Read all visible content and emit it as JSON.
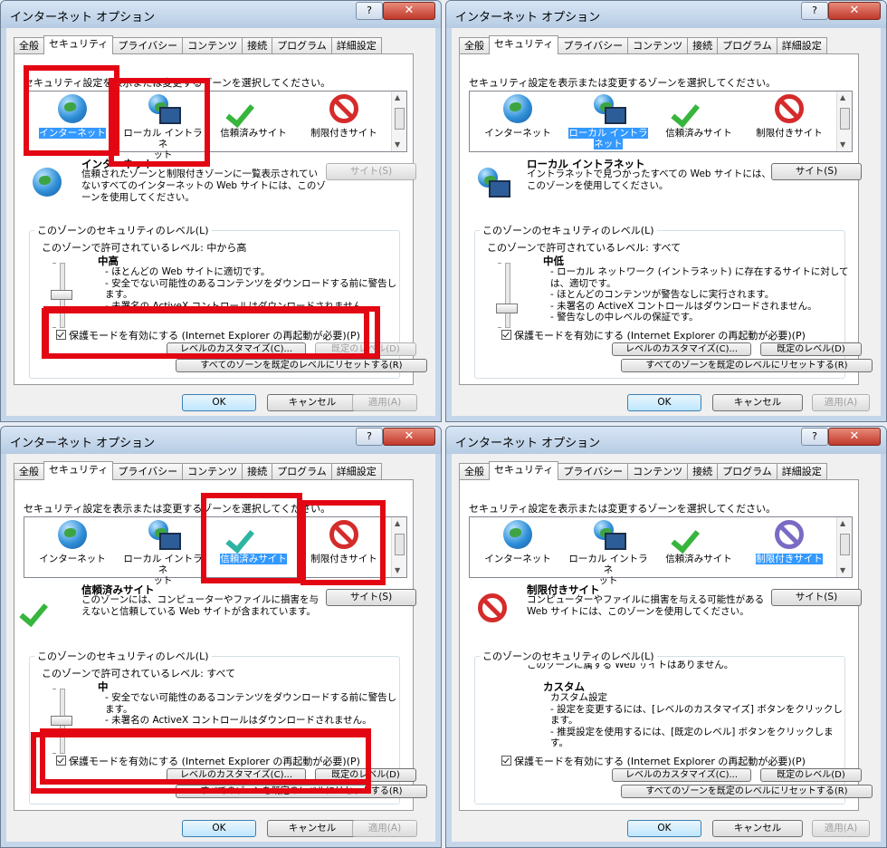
{
  "window_title": "インターネット オプション",
  "help_button": "?",
  "close_button": "✕",
  "tabs": [
    "全般",
    "セキュリティ",
    "プライバシー",
    "コンテンツ",
    "接続",
    "プログラム",
    "詳細設定"
  ],
  "prompt": "セキュリティ設定を表示または変更するゾーンを選択してください。",
  "zones": [
    "インターネット",
    "ローカル イントラネット",
    "信頼済みサイト",
    "制限付きサイト"
  ],
  "zone_label_lines": [
    [
      "インターネット"
    ],
    [
      "ローカル イントラネ",
      "ット"
    ],
    [
      "信頼済みサイト"
    ],
    [
      "制限付きサイト"
    ]
  ],
  "sites_button": "サイト(S)",
  "level_group": "このゾーンのセキュリティのレベル(L)",
  "protected_mode": "保護モードを有効にする (Internet Explorer の再起動が必要)(P)",
  "custom_level_button": "レベルのカスタマイズ(C)...",
  "default_level_button": "既定のレベル(D)",
  "reset_all_button": "すべてのゾーンを既定のレベルにリセットする(R)",
  "ok_button": "OK",
  "cancel_button": "キャンセル",
  "apply_button": "適用(A)",
  "panels": [
    {
      "selected_zone": 0,
      "zone_title": "インターネット",
      "zone_desc": "信頼されたゾーンと制限付きゾーンに一覧表示されていないすべてのインターネットの Web サイトには、このゾーンを使用してください。",
      "allowed_levels": "このゾーンで許可されているレベル: 中から高",
      "level_name": "中高",
      "level_desc": [
        "- ほとんどの Web サイトに適切です。",
        "- 安全でない可能性のあるコンテンツをダウンロードする前に警告します。",
        "- 未署名の ActiveX コントロールはダウンロードされません。"
      ],
      "slider_level": 0.5,
      "sites_enabled": false
    },
    {
      "selected_zone": 1,
      "zone_title": "ローカル イントラネット",
      "zone_desc": "イントラネットで見つかったすべての Web サイトには、このゾーンを使用してください。",
      "allowed_levels": "このゾーンで許可されているレベル: すべて",
      "level_name": "中低",
      "level_desc": [
        "- ローカル ネットワーク (イントラネット) に存在するサイトに対しては、適切です。",
        "- ほとんどのコンテンツが警告なしに実行されます。",
        "- 未署名の ActiveX コントロールはダウンロードされません。",
        "- 警告なしの中レベルの保証です。"
      ],
      "slider_level": 0.25,
      "sites_enabled": true
    },
    {
      "selected_zone": 2,
      "zone_title": "信頼済みサイト",
      "zone_desc": "このゾーンには、コンピューターやファイルに損害を与えないと信頼している Web サイトが含まれています。",
      "allowed_levels": "このゾーンで許可されているレベル: すべて",
      "level_name": "中",
      "level_desc": [
        "- 安全でない可能性のあるコンテンツをダウンロードする前に警告します。",
        "- 未署名の ActiveX コントロールはダウンロードされません。"
      ],
      "slider_level": 0.5,
      "sites_enabled": true
    },
    {
      "selected_zone": 3,
      "zone_title": "制限付きサイト",
      "zone_desc": "コンピューターやファイルに損害を与える可能性があるWeb サイトには、このゾーンを使用してください。",
      "no_sites": "このゾーンに属する Web サイトはありません。",
      "allowed_levels": "",
      "level_name": "カスタム",
      "level_desc": [
        "カスタム設定",
        "- 設定を変更するには、[レベルのカスタマイズ] ボタンをクリックします。",
        "- 推奨設定を使用するには、[既定のレベル] ボタンをクリックします。"
      ],
      "slider_level": null,
      "sites_enabled": true
    }
  ],
  "colors": {
    "highlight": "#e30613",
    "selection": "#3399ff"
  }
}
